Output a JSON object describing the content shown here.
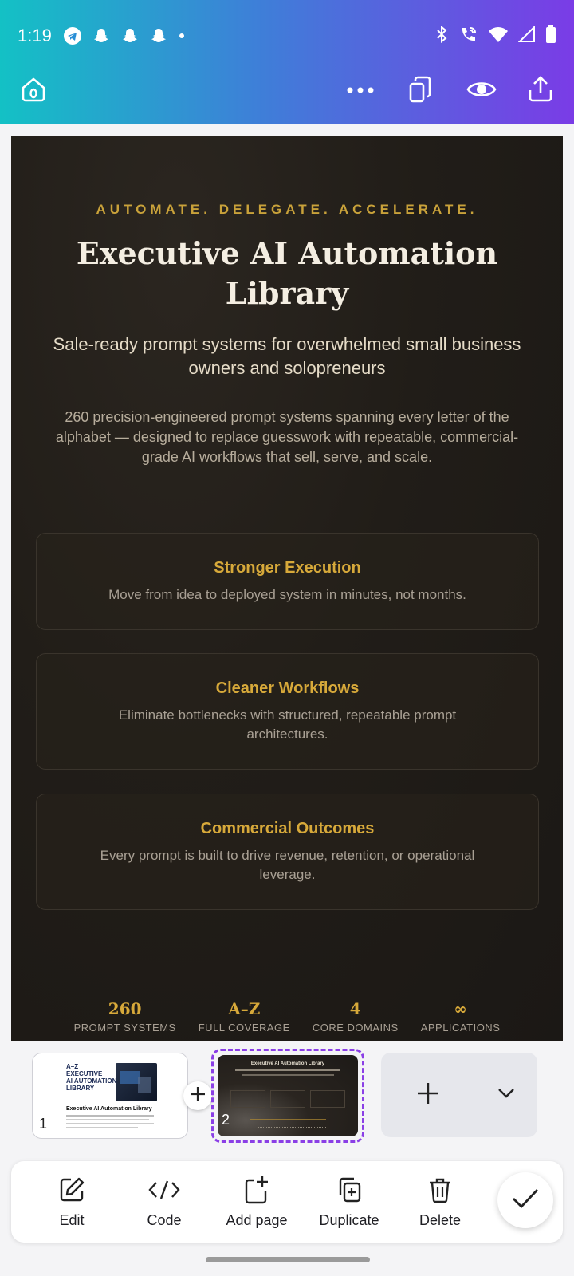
{
  "status_bar": {
    "time": "1:19",
    "icons": [
      "telegram-icon",
      "snapchat-icon",
      "snapchat-icon",
      "snapchat-icon",
      "dot-icon"
    ],
    "right_icons": [
      "bluetooth-icon",
      "wifi-call-icon",
      "wifi-icon",
      "signal-icon",
      "battery-icon"
    ]
  },
  "toolbar": {
    "home_icon": "home-icon",
    "more_icon": "more-icon",
    "pages_icon": "pages-icon",
    "preview_icon": "eye-icon",
    "share_icon": "share-icon"
  },
  "canvas": {
    "eyebrow": "AUTOMATE. DELEGATE. ACCELERATE.",
    "title_line1": "Executive AI Automation",
    "title_line2": "Library",
    "subtitle": "Sale-ready prompt systems for overwhelmed small business owners and solopreneurs",
    "description": "260 precision-engineered prompt systems spanning every letter of the alphabet — designed to replace guesswork with repeatable, commercial-grade AI workflows that sell, serve, and scale.",
    "cards": [
      {
        "title": "Stronger Execution",
        "text": "Move from idea to deployed system in minutes, not months."
      },
      {
        "title": "Cleaner Workflows",
        "text": "Eliminate bottlenecks with structured, repeatable prompt architectures."
      },
      {
        "title": "Commercial Outcomes",
        "text": "Every prompt is built to drive revenue, retention, or operational leverage."
      }
    ],
    "stats": [
      {
        "value": "260",
        "label": "PROMPT SYSTEMS"
      },
      {
        "value": "A–Z",
        "label": "FULL COVERAGE"
      },
      {
        "value": "4",
        "label": "CORE DOMAINS"
      },
      {
        "value": "∞",
        "label": "APPLICATIONS"
      }
    ],
    "colors": {
      "gold": "#d7a93a",
      "background": "#211d18"
    }
  },
  "pages": {
    "page1": {
      "number": "1",
      "thumb_heading_1": "A–Z",
      "thumb_heading_2": "EXECUTIVE",
      "thumb_heading_3": "AI AUTOMATION",
      "thumb_heading_4": "LIBRARY",
      "thumb_title": "Executive AI Automation Library"
    },
    "page2": {
      "number": "2",
      "thumb_title": "Executive AI Automation Library"
    },
    "selected_color": "#8b3fe6"
  },
  "actions": [
    {
      "label": "Edit",
      "icon": "edit-icon"
    },
    {
      "label": "Code",
      "icon": "code-icon"
    },
    {
      "label": "Add page",
      "icon": "add-page-icon"
    },
    {
      "label": "Duplicate",
      "icon": "duplicate-icon"
    },
    {
      "label": "Delete",
      "icon": "trash-icon"
    }
  ],
  "done_icon": "checkmark-icon"
}
